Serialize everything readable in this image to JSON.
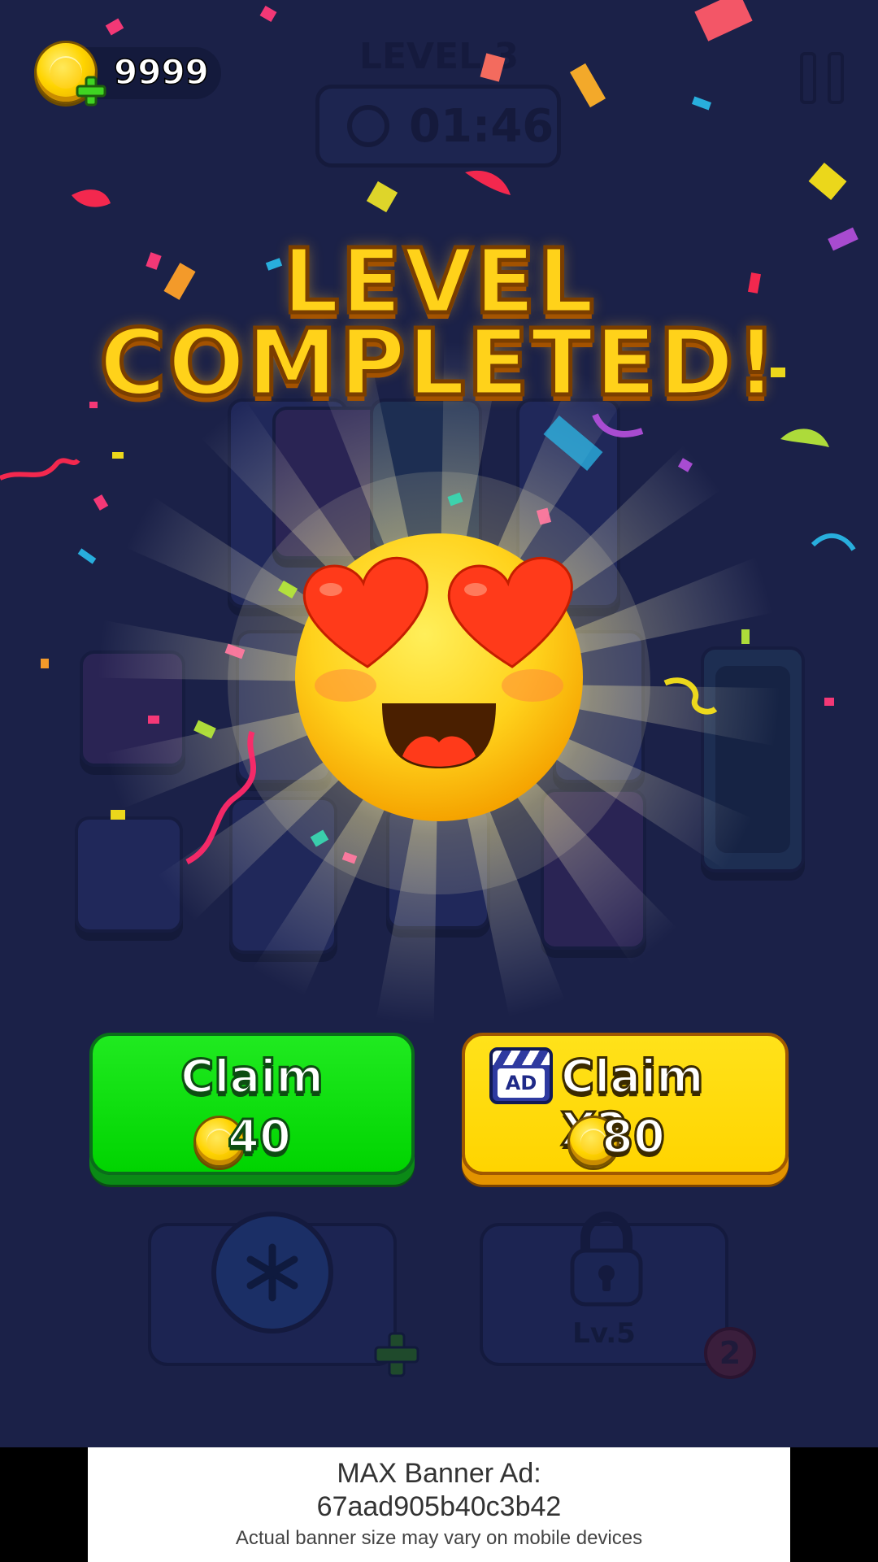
{
  "hud": {
    "coins": "9999",
    "level_label": "LEVEL 3",
    "timer": "01:46"
  },
  "banner_title": {
    "line1": "LEVEL",
    "line2": "COMPLETED!"
  },
  "rewards": {
    "claim": {
      "label": "Claim",
      "amount": "40"
    },
    "claim_x2": {
      "label": "Claim X2",
      "amount": "80",
      "ad_badge": "AD"
    }
  },
  "boosters": {
    "freeze_icon": "snowflake-icon",
    "locked_label": "Lv.5",
    "badge_count": "2"
  },
  "ad_banner": {
    "line1": "MAX Banner Ad:",
    "line2": "67aad905b40c3b42",
    "note": "Actual banner size may vary on mobile devices"
  },
  "colors": {
    "background": "#1b2148",
    "title_yellow": "#ffd21a",
    "claim_green": "#00d400",
    "claim_x2_yellow": "#ffd400"
  }
}
